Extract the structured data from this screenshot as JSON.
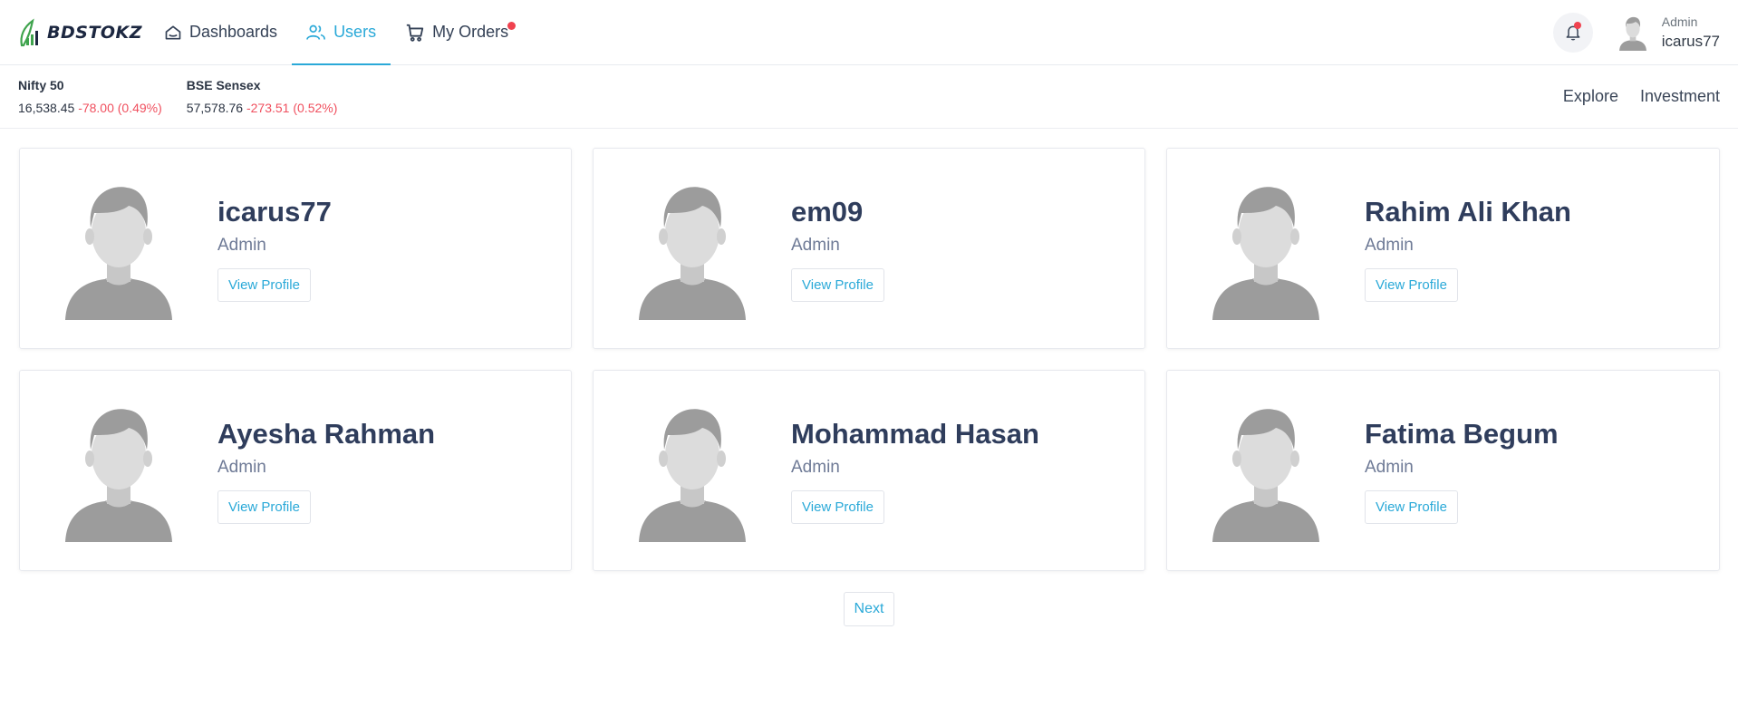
{
  "brand": {
    "name": "BDSTOKZ",
    "logo_icon": "growth-chart-leaf-icon",
    "colors": {
      "green": "#3fa34d",
      "dark": "#1c2740"
    }
  },
  "nav": {
    "items": [
      {
        "label": "Dashboards",
        "icon": "home-icon",
        "active": false
      },
      {
        "label": "Users",
        "icon": "users-icon",
        "active": true
      },
      {
        "label": "My Orders",
        "icon": "cart-icon",
        "active": false,
        "has_badge": true
      }
    ]
  },
  "header_user": {
    "role": "Admin",
    "name": "icarus77",
    "notification_icon": "bell-icon",
    "has_notification": true
  },
  "ticker": {
    "indices": [
      {
        "name": "Nifty 50",
        "value": "16,538.45",
        "change": "-78.00 (0.49%)"
      },
      {
        "name": "BSE Sensex",
        "value": "57,578.76",
        "change": "-273.51 (0.52%)"
      }
    ],
    "links": [
      "Explore",
      "Investment"
    ]
  },
  "users": [
    {
      "name": "icarus77",
      "role": "Admin",
      "action": "View Profile"
    },
    {
      "name": "em09",
      "role": "Admin",
      "action": "View Profile"
    },
    {
      "name": "Rahim Ali Khan",
      "role": "Admin",
      "action": "View Profile"
    },
    {
      "name": "Ayesha Rahman",
      "role": "Admin",
      "action": "View Profile"
    },
    {
      "name": "Mohammad Hasan",
      "role": "Admin",
      "action": "View Profile"
    },
    {
      "name": "Fatima Begum",
      "role": "Admin",
      "action": "View Profile"
    }
  ],
  "pagination": {
    "next_label": "Next"
  },
  "colors": {
    "accent": "#2aa9d8",
    "negative": "#f0505f",
    "badge": "#f0424f"
  }
}
